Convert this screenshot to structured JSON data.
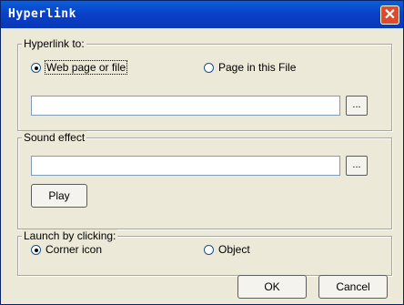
{
  "window": {
    "title": "Hyperlink"
  },
  "hyperlink_group": {
    "label": "Hyperlink to:",
    "options": [
      "Web page or file",
      "Page in this File"
    ],
    "selected": "Web page or file",
    "url_value": "",
    "browse_label": "..."
  },
  "sound_group": {
    "label": "Sound effect",
    "file_value": "",
    "browse_label": "...",
    "play_label": "Play"
  },
  "launch_group": {
    "label": "Launch by clicking:",
    "options": [
      "Corner icon",
      "Object"
    ],
    "selected": "Corner icon"
  },
  "buttons": {
    "ok": "OK",
    "cancel": "Cancel"
  },
  "icons": {
    "close": "close-icon"
  }
}
